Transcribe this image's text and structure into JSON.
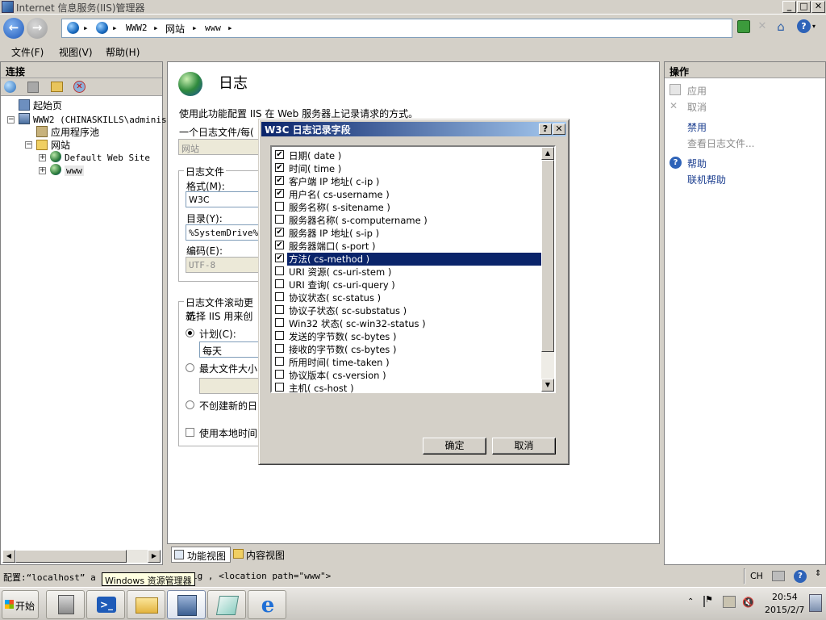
{
  "window": {
    "title": "Internet 信息服务(IIS)管理器",
    "controls": [
      "_",
      "□",
      "✕"
    ]
  },
  "address": {
    "crumbs": [
      "WWW2",
      "网站",
      "www"
    ],
    "separator": "▸"
  },
  "menu": {
    "file": "文件(F)",
    "view": "视图(V)",
    "help": "帮助(H)"
  },
  "left": {
    "header": "连接",
    "tree": {
      "start": "起始页",
      "server": "WWW2 (CHINASKILLS\\administ",
      "apppools": "应用程序池",
      "sites": "网站",
      "default_site": "Default Web Site",
      "www": "www"
    }
  },
  "center": {
    "title": "日志",
    "description": "使用此功能配置 IIS 在 Web 服务器上记录请求的方式。",
    "one_log_label": "一个日志文件/每(",
    "one_log_value": "网站",
    "logfile_group": "日志文件",
    "format_label": "格式(M):",
    "format_value": "W3C",
    "dir_label": "目录(Y):",
    "dir_value": "%SystemDrive%\\i",
    "encoding_label": "编码(E):",
    "encoding_value": "UTF-8",
    "rollover_group": "日志文件滚动更新",
    "rollover_desc": "选择 IIS 用来创",
    "schedule_label": "计划(C):",
    "schedule_value": "每天",
    "maxsize_label": "最大文件大小",
    "nonew_label": "不创建新的日",
    "localtime_label": "使用本地时间",
    "tab_features": "功能视图",
    "tab_content": "内容视图"
  },
  "right": {
    "header": "操作",
    "apply": "应用",
    "cancel": "取消",
    "disable": "禁用",
    "view_logs": "查看日志文件...",
    "help": "帮助",
    "online_help": "联机帮助"
  },
  "dialog": {
    "title": "W3C 日志记录字段",
    "help_btn": "?",
    "close_btn": "✕",
    "fields": [
      {
        "label": "日期( date )",
        "checked": true
      },
      {
        "label": "时间( time )",
        "checked": true
      },
      {
        "label": "客户端 IP 地址( c-ip )",
        "checked": true
      },
      {
        "label": "用户名( cs-username )",
        "checked": true
      },
      {
        "label": "服务名称( s-sitename )",
        "checked": false
      },
      {
        "label": "服务器名称( s-computername )",
        "checked": false
      },
      {
        "label": "服务器 IP 地址( s-ip )",
        "checked": true
      },
      {
        "label": "服务器端口( s-port )",
        "checked": true
      },
      {
        "label": "方法( cs-method )",
        "checked": true,
        "selected": true
      },
      {
        "label": "URI 资源( cs-uri-stem )",
        "checked": false
      },
      {
        "label": "URI 查询( cs-uri-query )",
        "checked": false
      },
      {
        "label": "协议状态( sc-status )",
        "checked": false
      },
      {
        "label": "协议子状态( sc-substatus )",
        "checked": false
      },
      {
        "label": "Win32 状态( sc-win32-status )",
        "checked": false
      },
      {
        "label": "发送的字节数( sc-bytes )",
        "checked": false
      },
      {
        "label": "接收的字节数( cs-bytes )",
        "checked": false
      },
      {
        "label": "所用时间( time-taken )",
        "checked": false
      },
      {
        "label": "协议版本( cs-version )",
        "checked": false
      },
      {
        "label": "主机( cs-host )",
        "checked": false
      }
    ],
    "ok": "确定",
    "cancel": "取消"
  },
  "status": {
    "text": "配置:“localhost”  a",
    "text2": "ig , <location path=\"www\">",
    "lang": "CH"
  },
  "tooltip": "Windows 资源管理器",
  "taskbar": {
    "start": "开始",
    "time": "20:54",
    "date": "2015/2/7"
  },
  "colors": {
    "selection": "#0a246a",
    "dialog_title_start": "#0a246a",
    "dialog_title_end": "#a6caf0",
    "window_face": "#d4d0c8"
  }
}
